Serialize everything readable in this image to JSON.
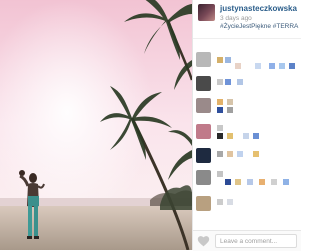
{
  "post": {
    "username": "justynasteczkowska",
    "time": "3 days ago",
    "caption": "#ŻycieJestPiękne #TERRA"
  },
  "comment_box": {
    "placeholder": "Leave a comment..."
  },
  "icons": {
    "like": "heart-icon"
  },
  "colors": {
    "username": "#2a5d8a",
    "caption": "#3a5a7a",
    "timestamp": "#9a9a9a",
    "sky_top": "#f1c8d6",
    "sand": "#c4b6a4"
  }
}
